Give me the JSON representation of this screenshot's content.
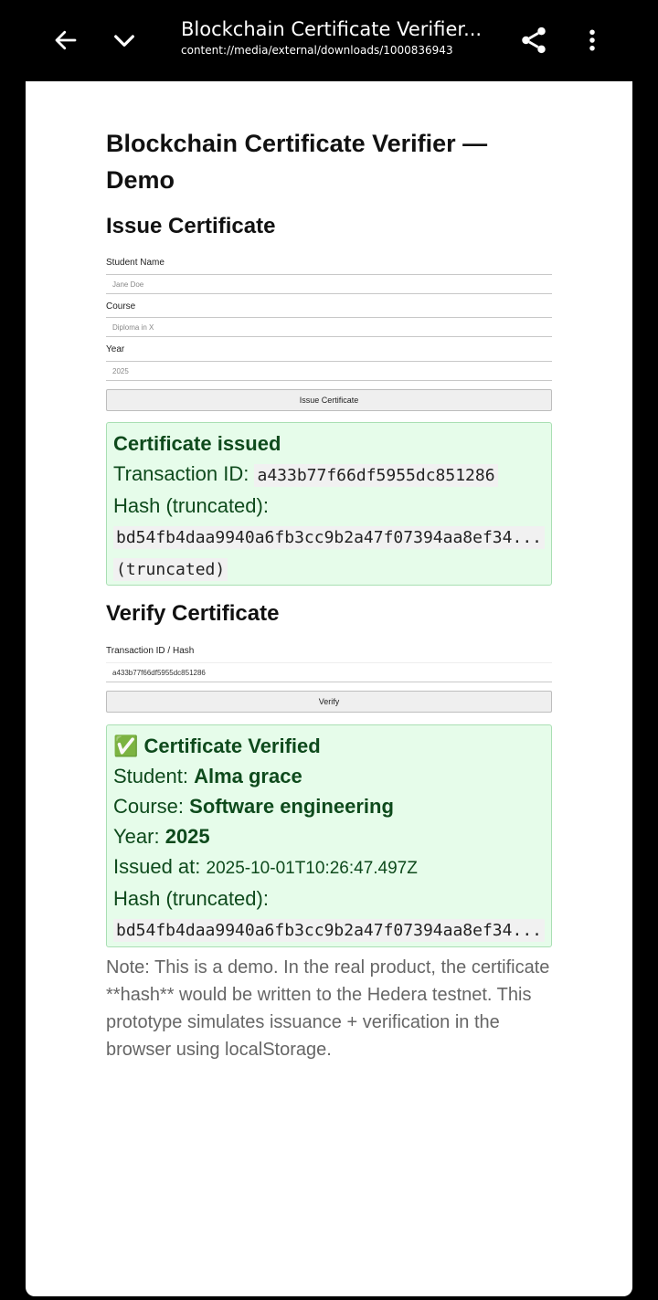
{
  "toolbar": {
    "title": "Blockchain Certificate Verifier...",
    "url": "content://media/external/downloads/1000836943"
  },
  "page": {
    "heading": "Blockchain Certificate Verifier — Demo",
    "issue_section": "Issue Certificate",
    "verify_section": "Verify Certificate",
    "note": "Note: This is a demo. In the real product, the certificate **hash** would be written to the Hedera testnet. This prototype simulates issuance + verification in the browser using localStorage."
  },
  "issue_form": {
    "student_label": "Student Name",
    "student_placeholder": "Jane Doe",
    "course_label": "Course",
    "course_placeholder": "Diploma in X",
    "year_label": "Year",
    "year_placeholder": "2025",
    "button_label": "Issue Certificate"
  },
  "issued": {
    "head": "Certificate issued",
    "tx_label": "Transaction ID:",
    "tx_value": "a433b77f66df5955dc851286",
    "hash_label": "Hash (truncated):",
    "hash_value": "bd54fb4daa9940a6fb3cc9b2a47f07394aa8ef34...",
    "hash_suffix": "(truncated)"
  },
  "verify_form": {
    "label": "Transaction ID / Hash",
    "value": "a433b77f66df5955dc851286",
    "button_label": "Verify"
  },
  "verified": {
    "check": "✅",
    "head": "Certificate Verified",
    "student_label": "Student:",
    "student_value": "Alma grace",
    "course_label": "Course:",
    "course_value": "Software engineering",
    "year_label": "Year:",
    "year_value": "2025",
    "issued_label": "Issued at:",
    "issued_value": "2025-10-01T10:26:47.497Z",
    "hash_label": "Hash (truncated):",
    "hash_value": "bd54fb4daa9940a6fb3cc9b2a47f07394aa8ef34..."
  }
}
